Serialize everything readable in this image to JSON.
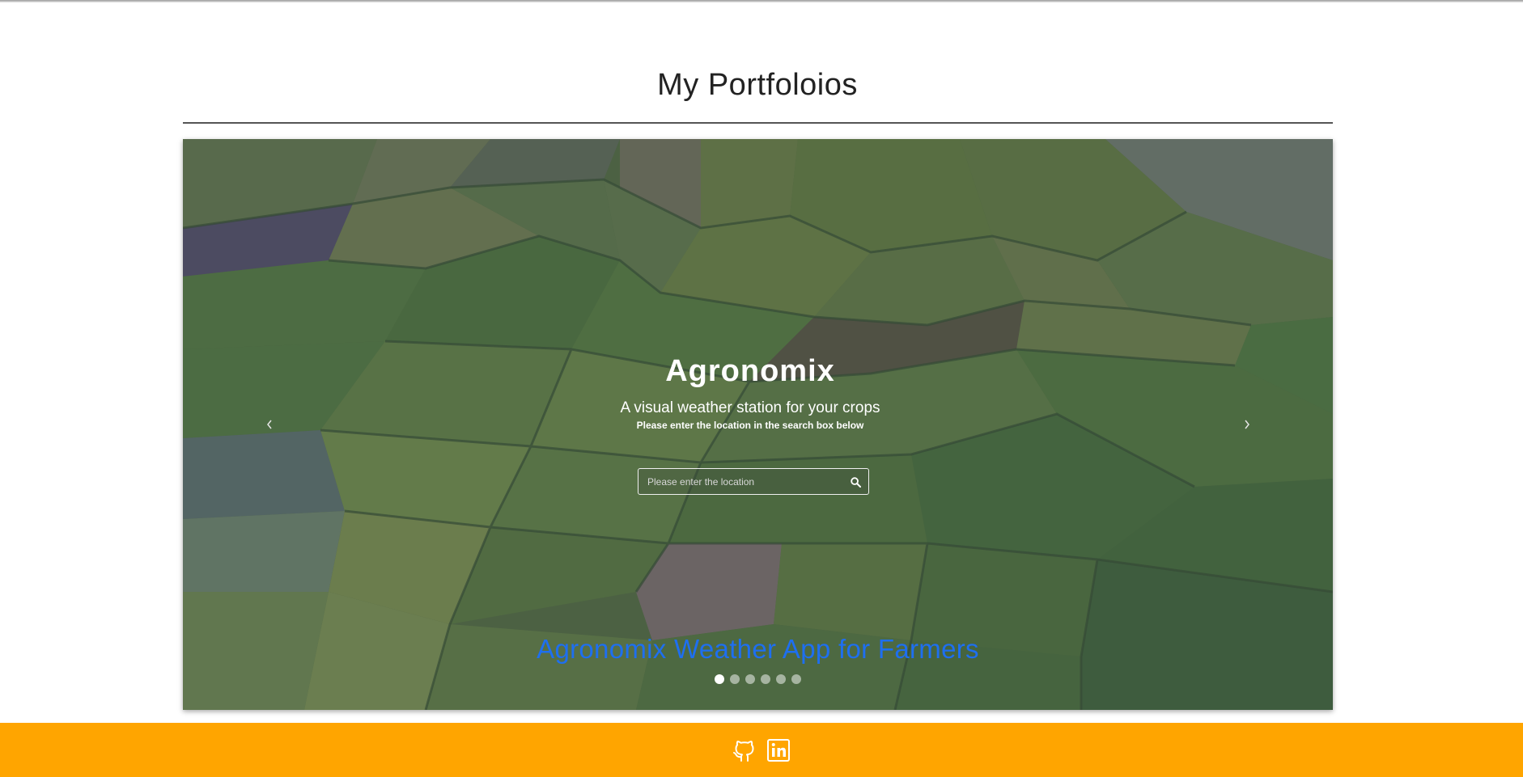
{
  "page": {
    "title": "My Portfoloios"
  },
  "carousel": {
    "app_title": "Agronomix",
    "app_subtitle": "A visual weather station for your crops",
    "app_hint": "Please enter the location in the search box below",
    "search_placeholder": "Please enter the location",
    "caption": "Agronomix Weather App for Farmers",
    "slide_count": 6,
    "active_slide": 1,
    "prev_icon": "chevron-left-icon",
    "next_icon": "chevron-right-icon",
    "search_icon": "search-icon"
  },
  "footer": {
    "background_color": "#ffa500",
    "links": [
      "github-icon",
      "linkedin-icon"
    ]
  },
  "colors": {
    "caption": "#1e6ff0",
    "footer": "#ffa500"
  }
}
